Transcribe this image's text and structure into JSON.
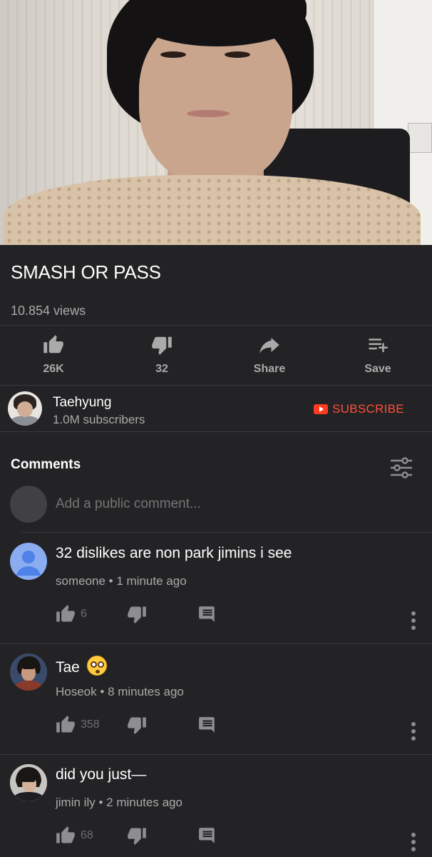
{
  "video": {
    "title": "SMASH OR PASS",
    "views": "10.854 views"
  },
  "actions": {
    "like_count": "26K",
    "dislike_count": "32",
    "share_label": "Share",
    "save_label": "Save"
  },
  "channel": {
    "name": "Taehyung",
    "subscribers": "1.0M subscribers",
    "subscribe_label": "SUBSCRIBE"
  },
  "comments": {
    "header": "Comments",
    "add_placeholder": "Add a public comment...",
    "items": [
      {
        "text": "32 dislikes are non park jimins i see",
        "author": "someone",
        "time": "1 minute ago",
        "likes": "6"
      },
      {
        "text": "Tae",
        "author": "Hoseok",
        "time": "8 minutes ago",
        "likes": "358"
      },
      {
        "text": "did you just—",
        "author": "jimin ily",
        "time": "2 minutes ago",
        "likes": "68"
      }
    ]
  },
  "meta_separator": "•",
  "colors": {
    "background": "#232325",
    "subscribe": "#ff4e3a",
    "secondary_text": "#aaaaaa"
  },
  "icons": [
    "thumbs-up-icon",
    "thumbs-down-icon",
    "share-icon",
    "playlist-add-icon",
    "filter-icon",
    "reply-icon",
    "more-vert-icon",
    "youtube-icon",
    "flushed-face-emoji"
  ]
}
